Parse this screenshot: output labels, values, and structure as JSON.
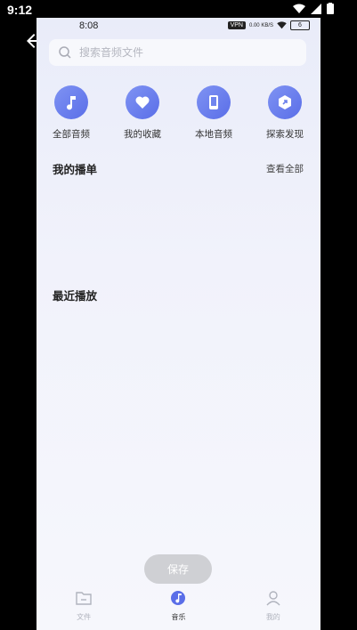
{
  "outer_status": {
    "time": "9:12"
  },
  "inner_status": {
    "time": "8:08",
    "vpn": "VPN",
    "speed": "0.00 KB/S",
    "battery": "6"
  },
  "search": {
    "placeholder": "搜索音频文件",
    "value": ""
  },
  "quick_actions": [
    {
      "label": "全部音频",
      "icon": "music-note-icon"
    },
    {
      "label": "我的收藏",
      "icon": "heart-icon"
    },
    {
      "label": "本地音频",
      "icon": "phone-icon"
    },
    {
      "label": "探索发现",
      "icon": "explore-icon"
    }
  ],
  "sections": {
    "playlists_title": "我的播单",
    "see_all": "查看全部",
    "recent_title": "最近播放"
  },
  "save_button": "保存",
  "bottom_nav": [
    {
      "label": "文件",
      "icon": "folder-icon",
      "active": false
    },
    {
      "label": "音乐",
      "icon": "music-disc-icon",
      "active": true
    },
    {
      "label": "我的",
      "icon": "person-icon",
      "active": false
    }
  ],
  "colors": {
    "accent": "#5a6ee8",
    "save_disabled": "#cfd0d4"
  }
}
